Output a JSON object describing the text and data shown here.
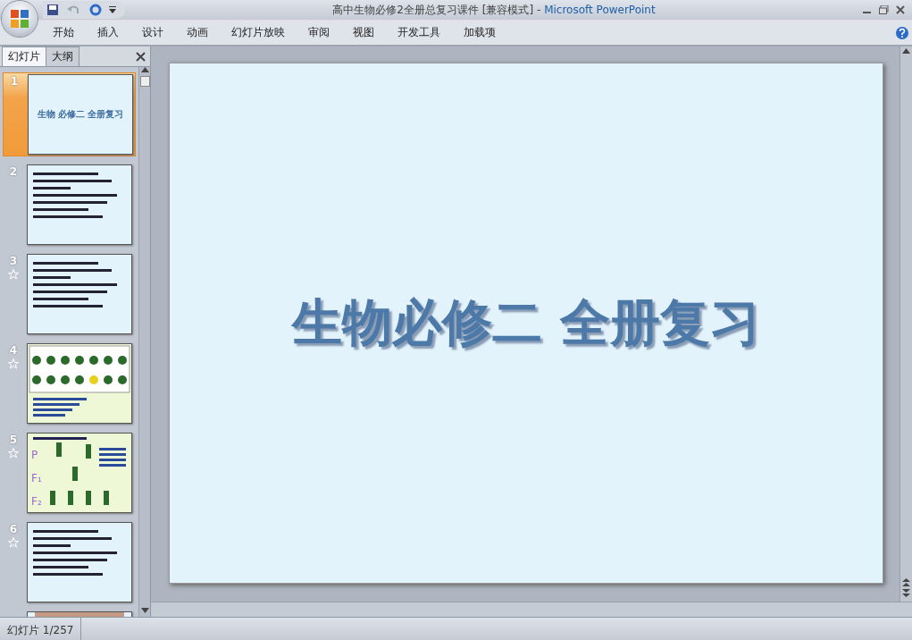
{
  "window": {
    "title": "高中生物必修2全册总复习课件 [兼容模式]",
    "separator": "-",
    "app_name": "Microsoft PowerPoint"
  },
  "ribbon_tabs": [
    {
      "label": "开始"
    },
    {
      "label": "插入"
    },
    {
      "label": "设计"
    },
    {
      "label": "动画"
    },
    {
      "label": "幻灯片放映"
    },
    {
      "label": "审阅"
    },
    {
      "label": "视图"
    },
    {
      "label": "开发工具"
    },
    {
      "label": "加载项"
    }
  ],
  "panel_tabs": [
    {
      "label": "幻灯片",
      "selected": true
    },
    {
      "label": "大纲",
      "selected": false
    }
  ],
  "slides": [
    {
      "number": "1",
      "selected": true,
      "animated": false,
      "kind": "title",
      "title": "生物 必修二 全册复习"
    },
    {
      "number": "2",
      "selected": false,
      "animated": false,
      "kind": "text"
    },
    {
      "number": "3",
      "selected": false,
      "animated": true,
      "kind": "text"
    },
    {
      "number": "4",
      "selected": false,
      "animated": true,
      "kind": "image-grid"
    },
    {
      "number": "5",
      "selected": false,
      "animated": true,
      "kind": "diagram",
      "labels": [
        "P",
        "F₁",
        "F₂"
      ]
    },
    {
      "number": "6",
      "selected": false,
      "animated": true,
      "kind": "text"
    },
    {
      "selected": false,
      "animated": false,
      "kind": "photo"
    }
  ],
  "slide": {
    "title": "生物必修二 全册复习"
  },
  "status_bar": {
    "slide_counter": "幻灯片 1/257"
  }
}
